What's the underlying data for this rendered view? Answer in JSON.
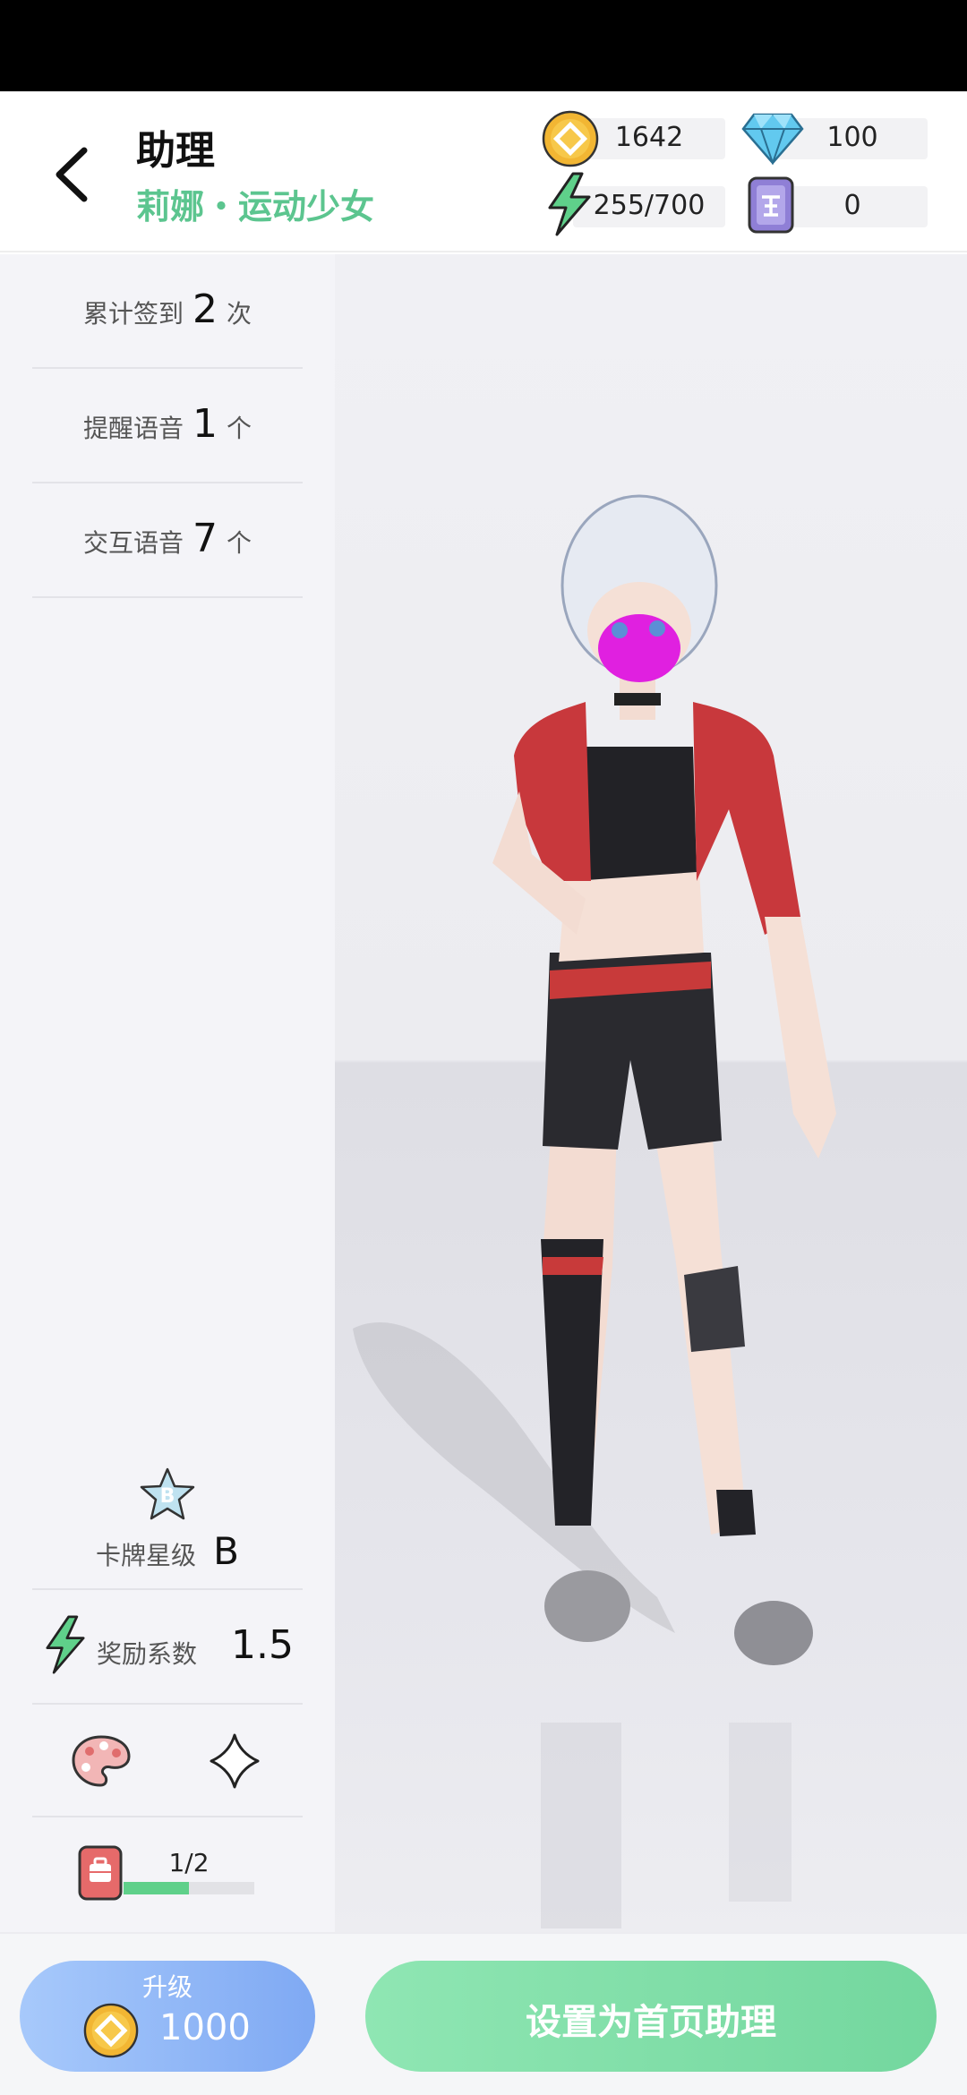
{
  "header": {
    "title": "助理",
    "subtitle": "莉娜・运动少女"
  },
  "resources": {
    "coins": "1642",
    "diamonds": "100",
    "energy": "255/700",
    "tickets": "0"
  },
  "stats": [
    {
      "label": "累计签到",
      "value": "2",
      "unit": "次"
    },
    {
      "label": "提醒语音",
      "value": "1",
      "unit": "个"
    },
    {
      "label": "交互语音",
      "value": "7",
      "unit": "个"
    }
  ],
  "card": {
    "star_badge": "B",
    "star_label": "卡牌星级",
    "star_value": "B",
    "reward_label": "奖励系数",
    "reward_value": "1.5"
  },
  "inventory": {
    "count": "1/2",
    "progress": 0.5
  },
  "buttons": {
    "upgrade_label": "升级",
    "upgrade_cost": "1000",
    "set_home_label": "设置为首页助理"
  },
  "colors": {
    "accent_green": "#5cc58f",
    "upgrade_blue": "#7fa9f3",
    "progress_green": "#5fd08a"
  }
}
